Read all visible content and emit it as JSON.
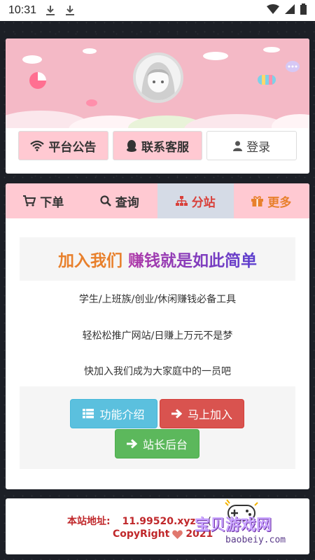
{
  "status": {
    "time": "10:31"
  },
  "top_nav": {
    "notice": "平台公告",
    "service": "联系客服",
    "login": "登录"
  },
  "tabs": [
    {
      "label": "下单"
    },
    {
      "label": "查询"
    },
    {
      "label": "分站"
    },
    {
      "label": "更多"
    }
  ],
  "hero": {
    "part1": "加入我们",
    "part2": "赚钱就是如此简单"
  },
  "lines": [
    "学生/上班族/创业/休闲赚钱必备工具",
    "轻松松推广网站/日赚上万元不是梦",
    "快加入我们成为大家庭中的一员吧"
  ],
  "buttons": {
    "features": "功能介绍",
    "join": "马上加入",
    "admin": "站长后台"
  },
  "footer": {
    "address_label": "本站地址:",
    "address": "11.99520.xyz",
    "extra": "(",
    "copyright": "CopyRight",
    "year": "2021"
  },
  "watermark": {
    "title": "宝贝游戏网",
    "domain": "baobeiy.com"
  },
  "colors": {
    "pink": "#ffc9d2",
    "active_tab": "#d5dbe6",
    "accent_red": "#d9403a",
    "accent_orange": "#e8802c"
  }
}
